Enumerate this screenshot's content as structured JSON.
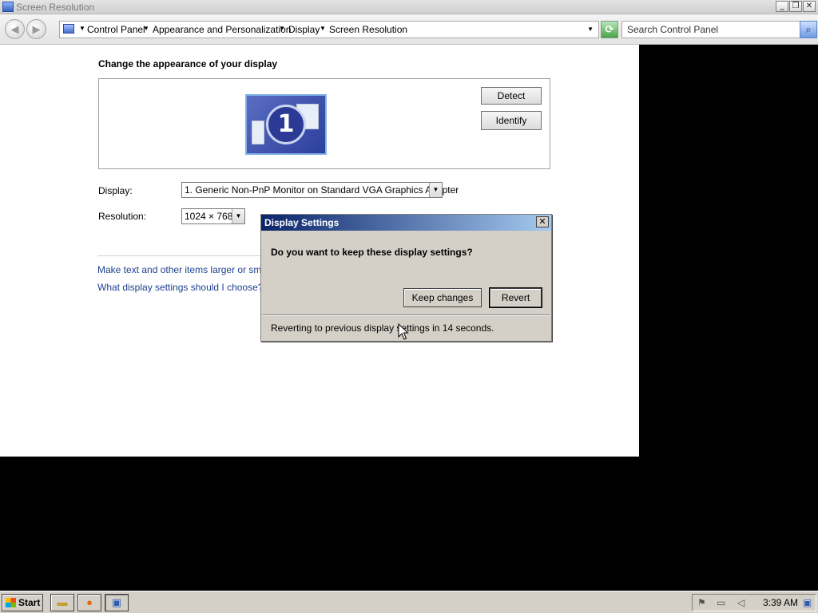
{
  "window": {
    "title": "Screen Resolution",
    "caption_buttons": {
      "minimize": "_",
      "restore": "❐",
      "close": "✕"
    }
  },
  "nav": {
    "back_glyph": "◀",
    "forward_glyph": "▶",
    "breadcrumbs": [
      "Control Panel",
      "Appearance and Personalization",
      "Display",
      "Screen Resolution"
    ],
    "search_placeholder": "Search Control Panel",
    "refresh_glyph": "⟳",
    "search_glyph": "⌕"
  },
  "main": {
    "heading": "Change the appearance of your display",
    "monitor_number": "1",
    "detect_label": "Detect",
    "identify_label": "Identify",
    "display_label": "Display:",
    "display_value": "1. Generic Non-PnP Monitor on Standard VGA Graphics Adapter",
    "resolution_label": "Resolution:",
    "resolution_value": "1024 × 768",
    "links": [
      "Make text and other items larger or smaller",
      "What display settings should I choose?"
    ]
  },
  "dialog": {
    "title": "Display Settings",
    "question": "Do you want to keep these display settings?",
    "keep_label": "Keep changes",
    "revert_label": "Revert",
    "status": "Reverting to previous display settings in 14 seconds.",
    "close_glyph": "✕"
  },
  "taskbar": {
    "start_label": "Start",
    "clock": "3:39 AM",
    "tray_icons": [
      "flag-icon",
      "network-icon",
      "speaker-icon",
      "show-desktop-icon"
    ]
  },
  "colors": {
    "dialog_title_start": "#0a246a",
    "dialog_title_end": "#a6caf0",
    "link": "#1f3f8f",
    "taskbar": "#d4d0c8"
  }
}
